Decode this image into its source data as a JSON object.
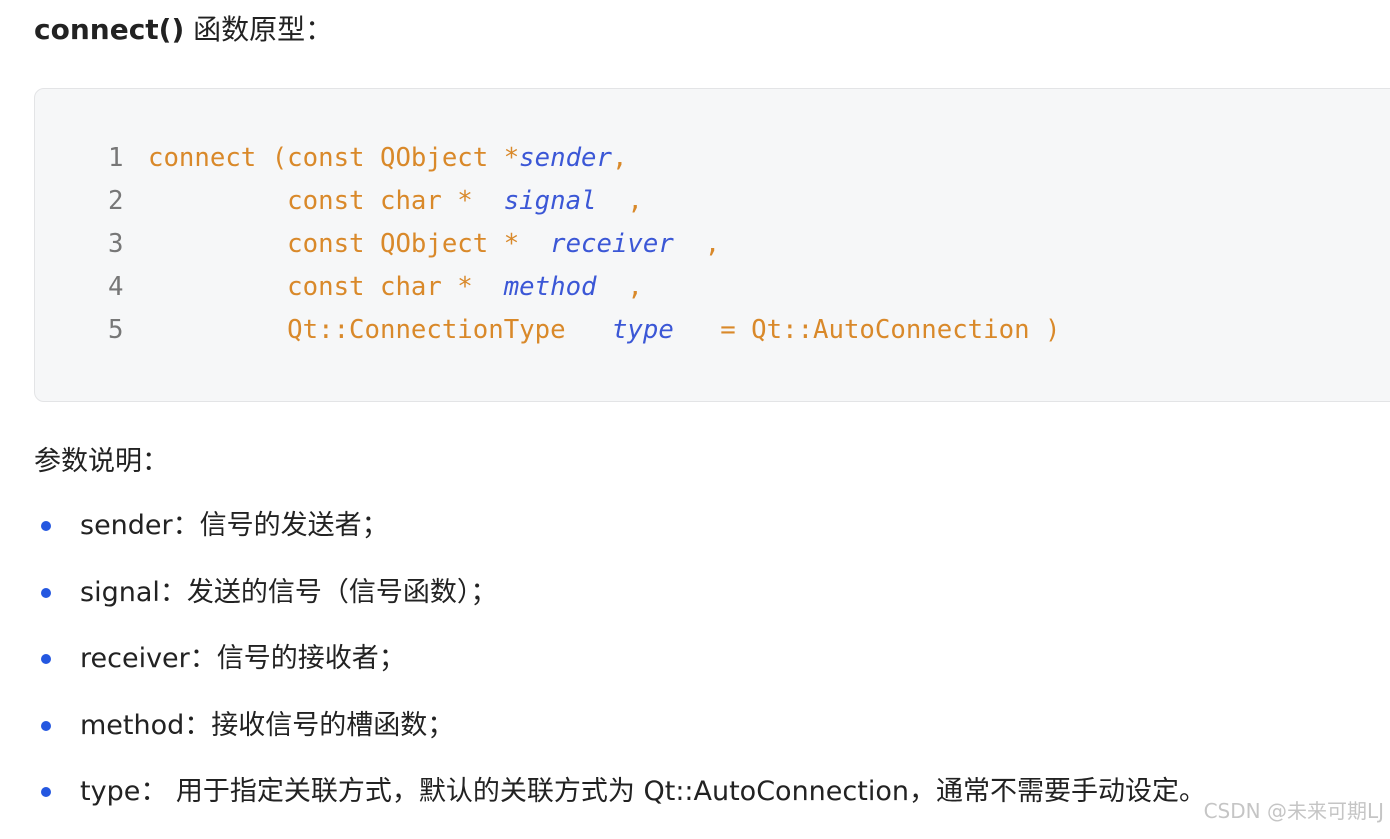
{
  "heading": {
    "bold": "connect()",
    "rest": " 函数原型："
  },
  "code": {
    "lines": [
      {
        "n": "1",
        "parts": [
          [
            "k",
            "connect (const QObject *"
          ],
          [
            "v",
            "sender"
          ],
          [
            "k",
            ","
          ]
        ]
      },
      {
        "n": "2",
        "parts": [
          [
            "k",
            "         const char *  "
          ],
          [
            "v",
            "signal"
          ],
          [
            "k",
            "  ,"
          ]
        ]
      },
      {
        "n": "3",
        "parts": [
          [
            "k",
            "         const QObject *  "
          ],
          [
            "v",
            "receiver"
          ],
          [
            "k",
            "  ,"
          ]
        ]
      },
      {
        "n": "4",
        "parts": [
          [
            "k",
            "         const char *  "
          ],
          [
            "v",
            "method"
          ],
          [
            "k",
            "  ,"
          ]
        ]
      },
      {
        "n": "5",
        "parts": [
          [
            "k",
            "         Qt::ConnectionType   "
          ],
          [
            "v",
            "type"
          ],
          [
            "k",
            "   = Qt::AutoConnection )"
          ]
        ]
      }
    ]
  },
  "params_title": "参数说明：",
  "params": [
    "sender：信号的发送者；",
    "signal：发送的信号（信号函数）；",
    "receiver：信号的接收者；",
    "method：接收信号的槽函数；",
    "type： 用于指定关联方式，默认的关联方式为 Qt::AutoConnection，通常不需要手动设定。"
  ],
  "watermark": "CSDN @未来可期LJ",
  "colors": {
    "keyword": "#d9892a",
    "variable": "#3b57d6",
    "bullet": "#2457e0",
    "code_bg": "#f6f7f8"
  }
}
